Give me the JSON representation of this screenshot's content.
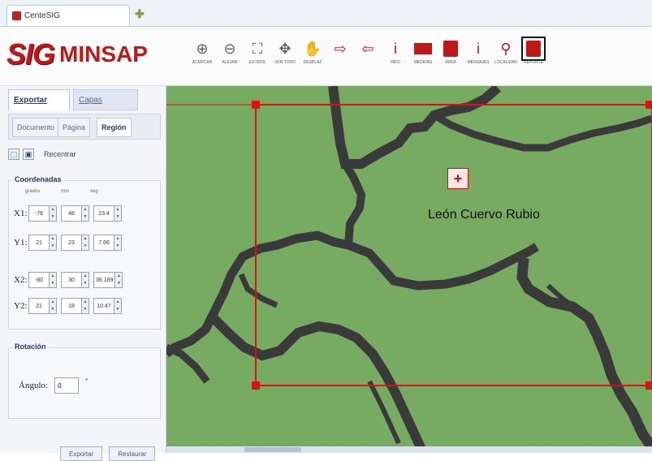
{
  "window": {
    "tab_title": "CenteSIG",
    "new_tab_glyph": "✚"
  },
  "brand": {
    "logo_sig": "SIG",
    "logo_minsap": "MINSAP"
  },
  "toolbar": [
    {
      "icon": "zoom-in-icon",
      "glyph": "⊕",
      "label": "ACERCAR",
      "style": "dark"
    },
    {
      "icon": "zoom-out-icon",
      "glyph": "⊖",
      "label": "ALEJAR",
      "style": "dark"
    },
    {
      "icon": "extent-icon",
      "glyph": "⛶",
      "label": "EXTENS",
      "style": "dark"
    },
    {
      "icon": "full-view-icon",
      "glyph": "✥",
      "label": "VER TODO",
      "style": "dark"
    },
    {
      "icon": "pan-icon",
      "glyph": "✋",
      "label": "DESPLAZ",
      "style": "red"
    },
    {
      "icon": "arrow-right-icon",
      "glyph": "⇨",
      "label": "",
      "style": "red"
    },
    {
      "icon": "arrow-left-icon",
      "glyph": "⇦",
      "label": "",
      "style": "red"
    },
    {
      "icon": "info-icon",
      "glyph": "i",
      "label": "INFO",
      "style": "red"
    },
    {
      "icon": "measure-icon",
      "glyph": "▬",
      "label": "MEDIDAS",
      "style": "red-block"
    },
    {
      "icon": "area-icon",
      "glyph": "▦",
      "label": "AREA",
      "style": "red-icon"
    },
    {
      "icon": "warning-icon",
      "glyph": "i",
      "label": "MENSAJES",
      "style": "red"
    },
    {
      "icon": "location-icon",
      "glyph": "⚲",
      "label": "LOCALIZAR",
      "style": "red"
    },
    {
      "icon": "report-icon",
      "glyph": "▤",
      "label": "REPORTE",
      "style": "red-icon-selected"
    }
  ],
  "panel": {
    "tabs": [
      "Exportar",
      "Capas"
    ],
    "subtabs": [
      "Documento",
      "Página",
      "Región"
    ],
    "actions": {
      "refresh_label": "Recentrar"
    },
    "coords_title": "Coordenadas",
    "coord_columns": [
      "grados",
      "min",
      "seg"
    ],
    "coords": [
      {
        "label": "X1:",
        "values": [
          "-76",
          "48",
          "23.4"
        ]
      },
      {
        "label": "Y1:",
        "values": [
          "21",
          "23",
          "7.66"
        ]
      },
      {
        "label": "X2:",
        "values": [
          "-80",
          "30",
          "36.189"
        ]
      },
      {
        "label": "Y2:",
        "values": [
          "21",
          "18",
          "10.47"
        ]
      }
    ],
    "rotation_title": "Rotación",
    "angle_label": "Ángulo:",
    "angle_value": "0",
    "degree": "°",
    "buttons": [
      "Exportar",
      "Restaurar"
    ]
  },
  "map": {
    "place_name": "León Cuervo Rubio",
    "colors": {
      "land": "#76ab61",
      "border": "#3a3a3a",
      "selection": "#e01010"
    }
  }
}
